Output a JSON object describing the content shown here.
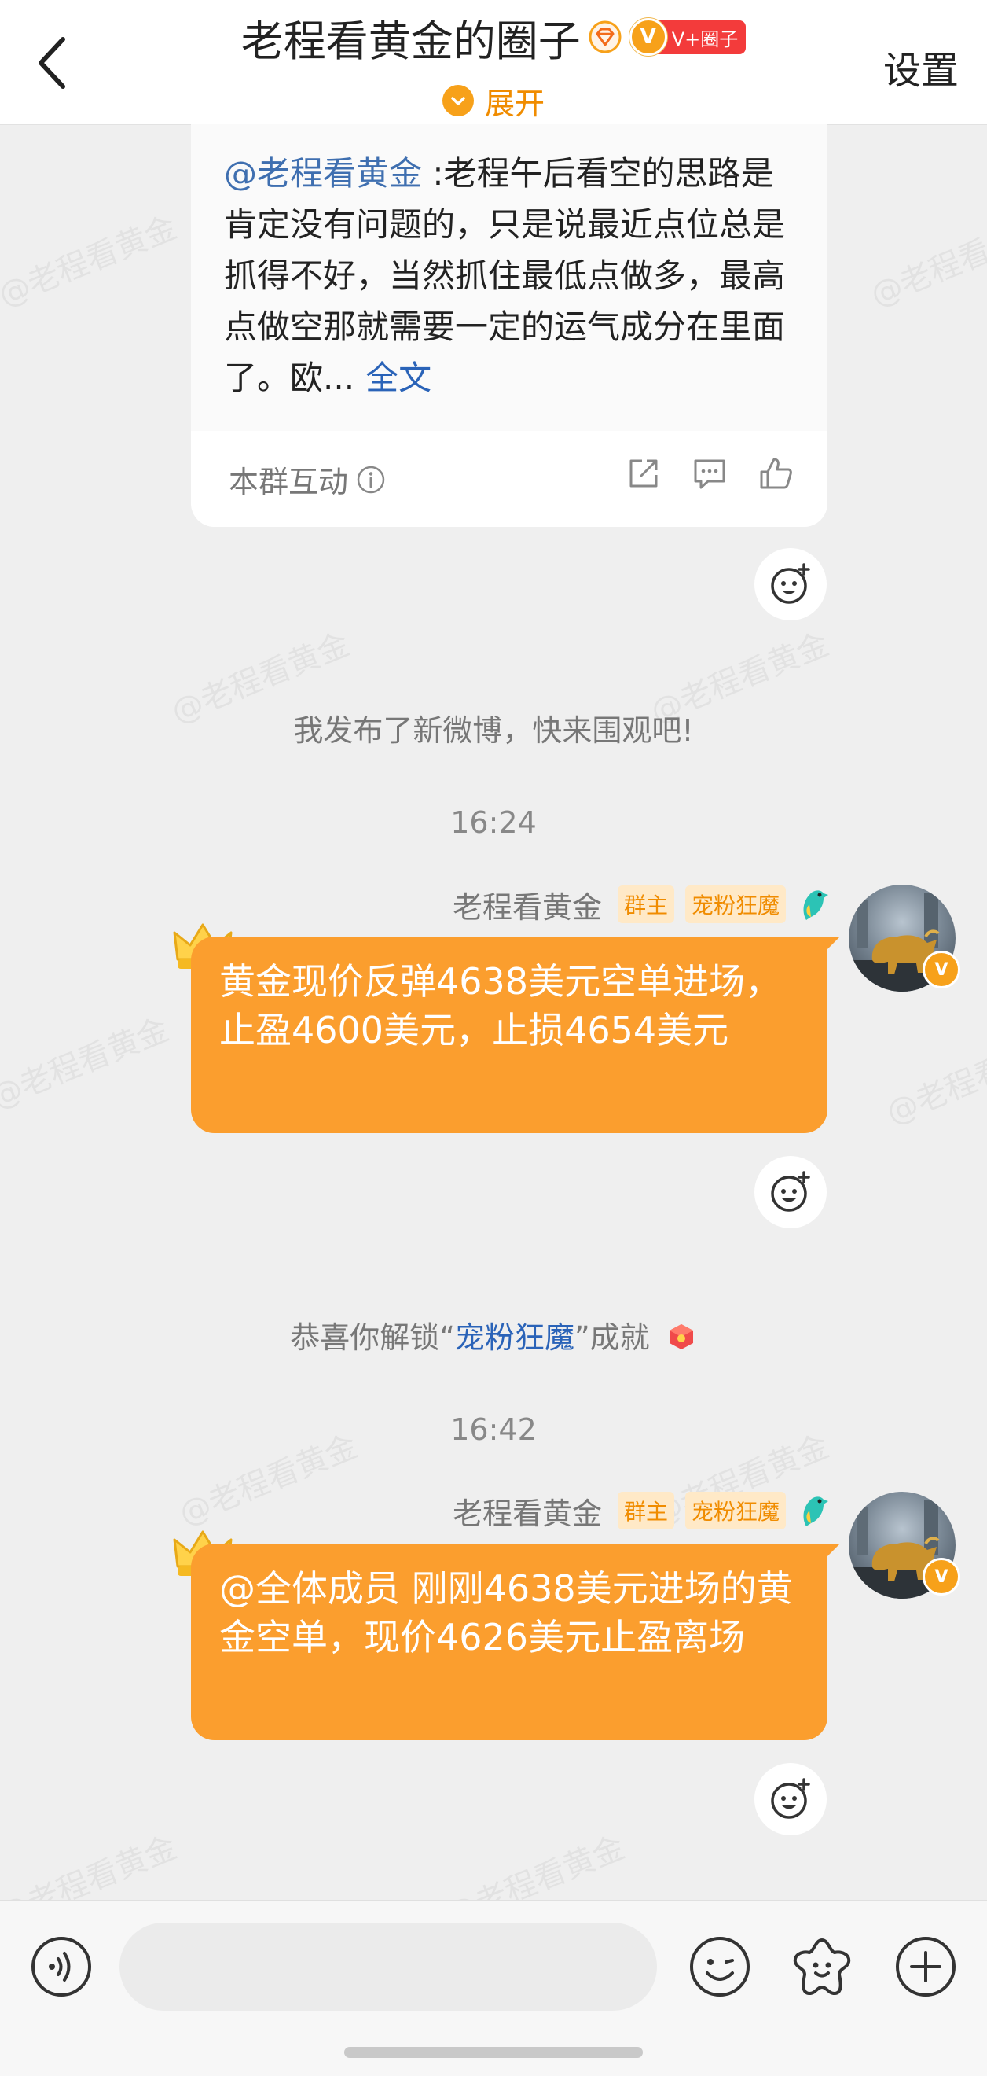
{
  "header": {
    "title": "老程看黄金的圈子",
    "badge_text": "V+圈子",
    "vip_letter": "V",
    "expand_label": "展开",
    "settings_label": "设置"
  },
  "watermark": "@老程看黄金",
  "post_card": {
    "mention": "@老程看黄金",
    "body": " :老程午后看空的思路是肯定没有问题的，只是说最近点位总是抓得不好，当然抓住最低点做多，最高点做空那就需要一定的运气成分在里面了。欧...",
    "full_text_link": "全文",
    "footer_label": "本群互动"
  },
  "system_messages": {
    "new_post": "我发布了新微博，快来围观吧!",
    "achievement_prefix": "恭喜你解锁“",
    "achievement_name": "宠粉狂魔",
    "achievement_suffix": "”成就"
  },
  "messages": [
    {
      "time": "16:24",
      "sender": "老程看黄金",
      "tags": [
        "群主",
        "宠粉狂魔"
      ],
      "text": "黄金现价反弹4638美元空单进场，止盈4600美元，止损4654美元"
    },
    {
      "time": "16:42",
      "sender": "老程看黄金",
      "tags": [
        "群主",
        "宠粉狂魔"
      ],
      "text": "@全体成员 刚刚4638美元进场的黄金空单，现价4626美元止盈离场"
    }
  ],
  "input": {
    "value": "",
    "placeholder": ""
  },
  "colors": {
    "accent": "#fb9e2e",
    "link": "#2a63b8",
    "vip": "#f7a11a",
    "badge_red": "#f33b3b"
  },
  "icons": [
    "back-arrow-icon",
    "diamond-icon",
    "vip-icon",
    "info-icon",
    "share-icon",
    "comment-icon",
    "like-icon",
    "add-reaction-icon",
    "bird-icon",
    "crown-icon",
    "voice-icon",
    "emoji-icon",
    "sticker-icon",
    "plus-icon"
  ]
}
